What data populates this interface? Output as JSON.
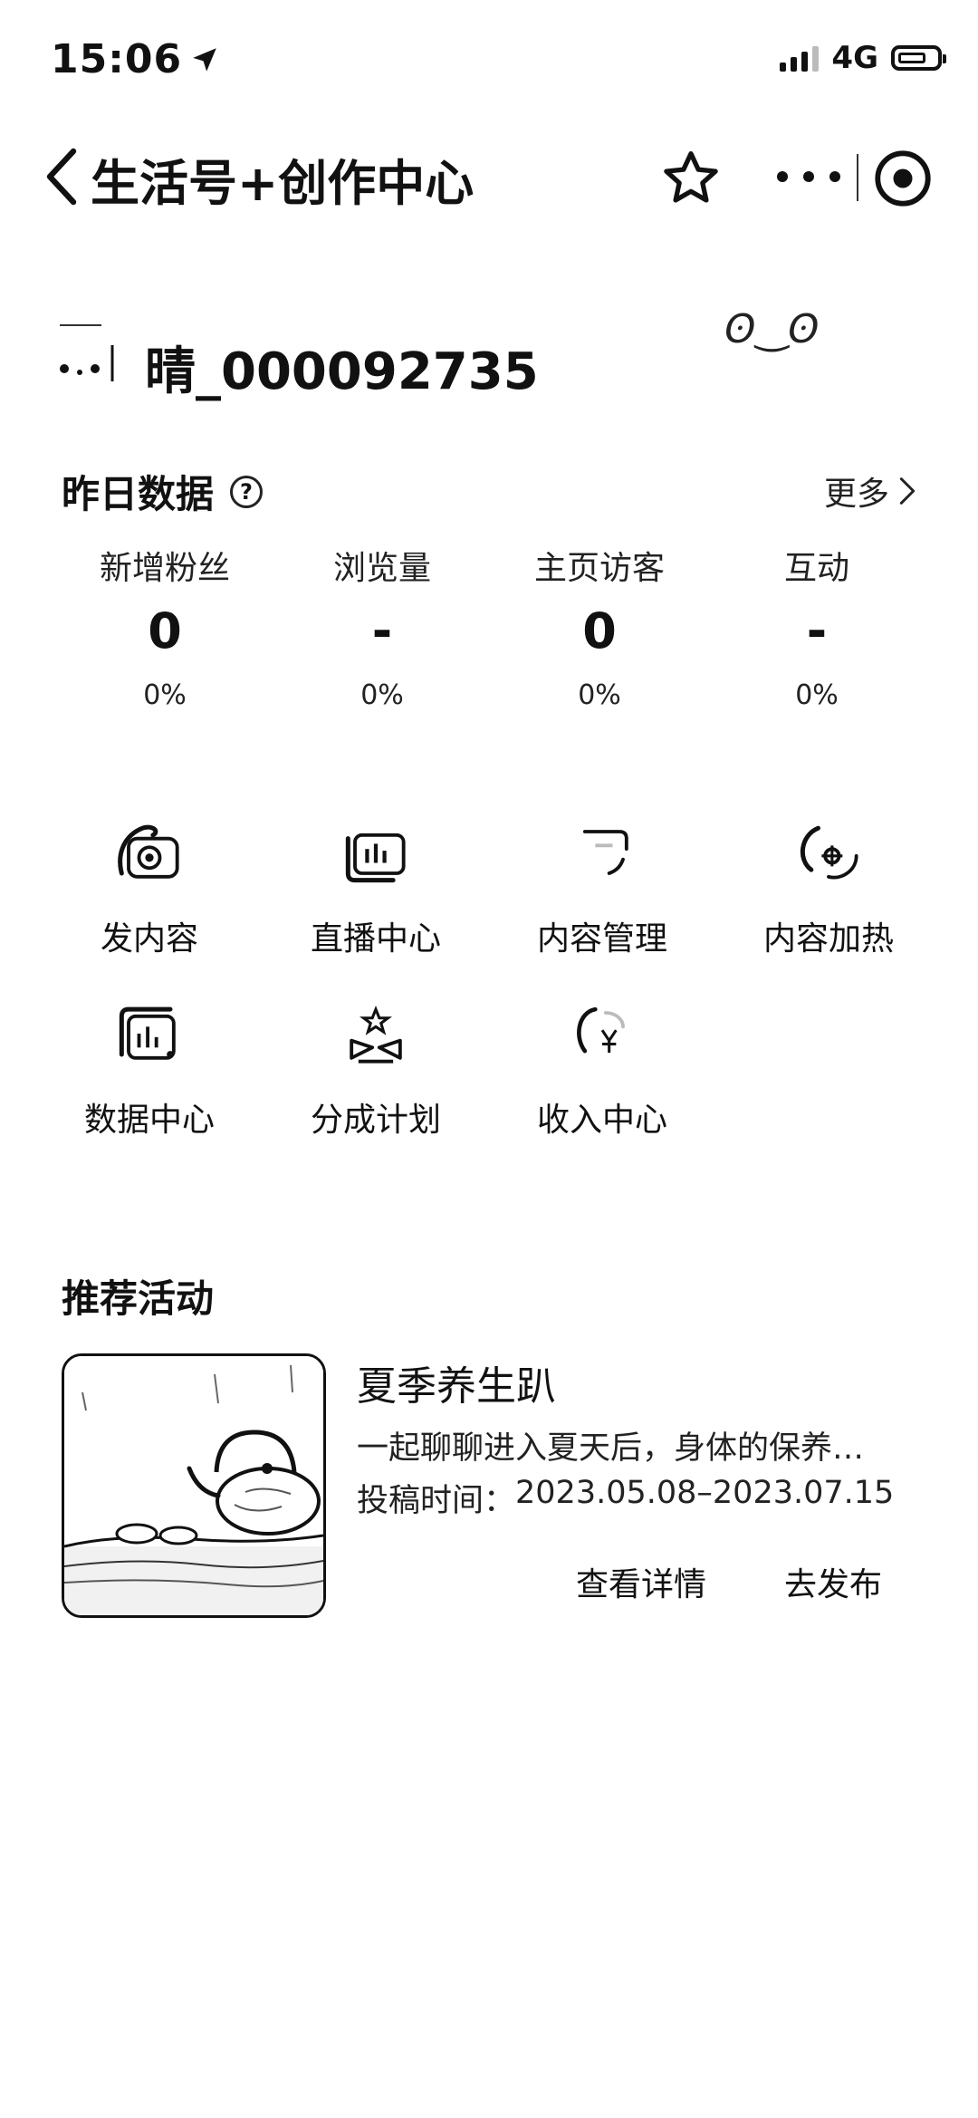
{
  "status_bar": {
    "time": "15:06",
    "network": "4G"
  },
  "nav": {
    "title": "生活号+创作中心"
  },
  "profile": {
    "username": "晴_000092735",
    "decoration": "ʘ‿ʘ"
  },
  "yesterday": {
    "title": "昨日数据",
    "help": "?",
    "more": "更多",
    "stats": [
      {
        "label": "新增粉丝",
        "value": "0",
        "change": "0%"
      },
      {
        "label": "浏览量",
        "value": "-",
        "change": "0%"
      },
      {
        "label": "主页访客",
        "value": "0",
        "change": "0%"
      },
      {
        "label": "互动",
        "value": "-",
        "change": "0%"
      }
    ]
  },
  "tools": [
    {
      "label": "发内容",
      "icon": "camera-icon"
    },
    {
      "label": "直播中心",
      "icon": "live-icon"
    },
    {
      "label": "内容管理",
      "icon": "content-manage-icon"
    },
    {
      "label": "内容加热",
      "icon": "boost-icon"
    },
    {
      "label": "数据中心",
      "icon": "chart-icon"
    },
    {
      "label": "分成计划",
      "icon": "gift-icon"
    },
    {
      "label": "收入中心",
      "icon": "income-icon"
    }
  ],
  "activity": {
    "section_title": "推荐活动",
    "name": "夏季养生趴",
    "description": "一起聊聊进入夏天后，身体的保养…",
    "date_label": "投稿时间：",
    "date_range": "2023.05.08–2023.07.15",
    "detail_button": "查看详情",
    "publish_button": "去发布"
  }
}
